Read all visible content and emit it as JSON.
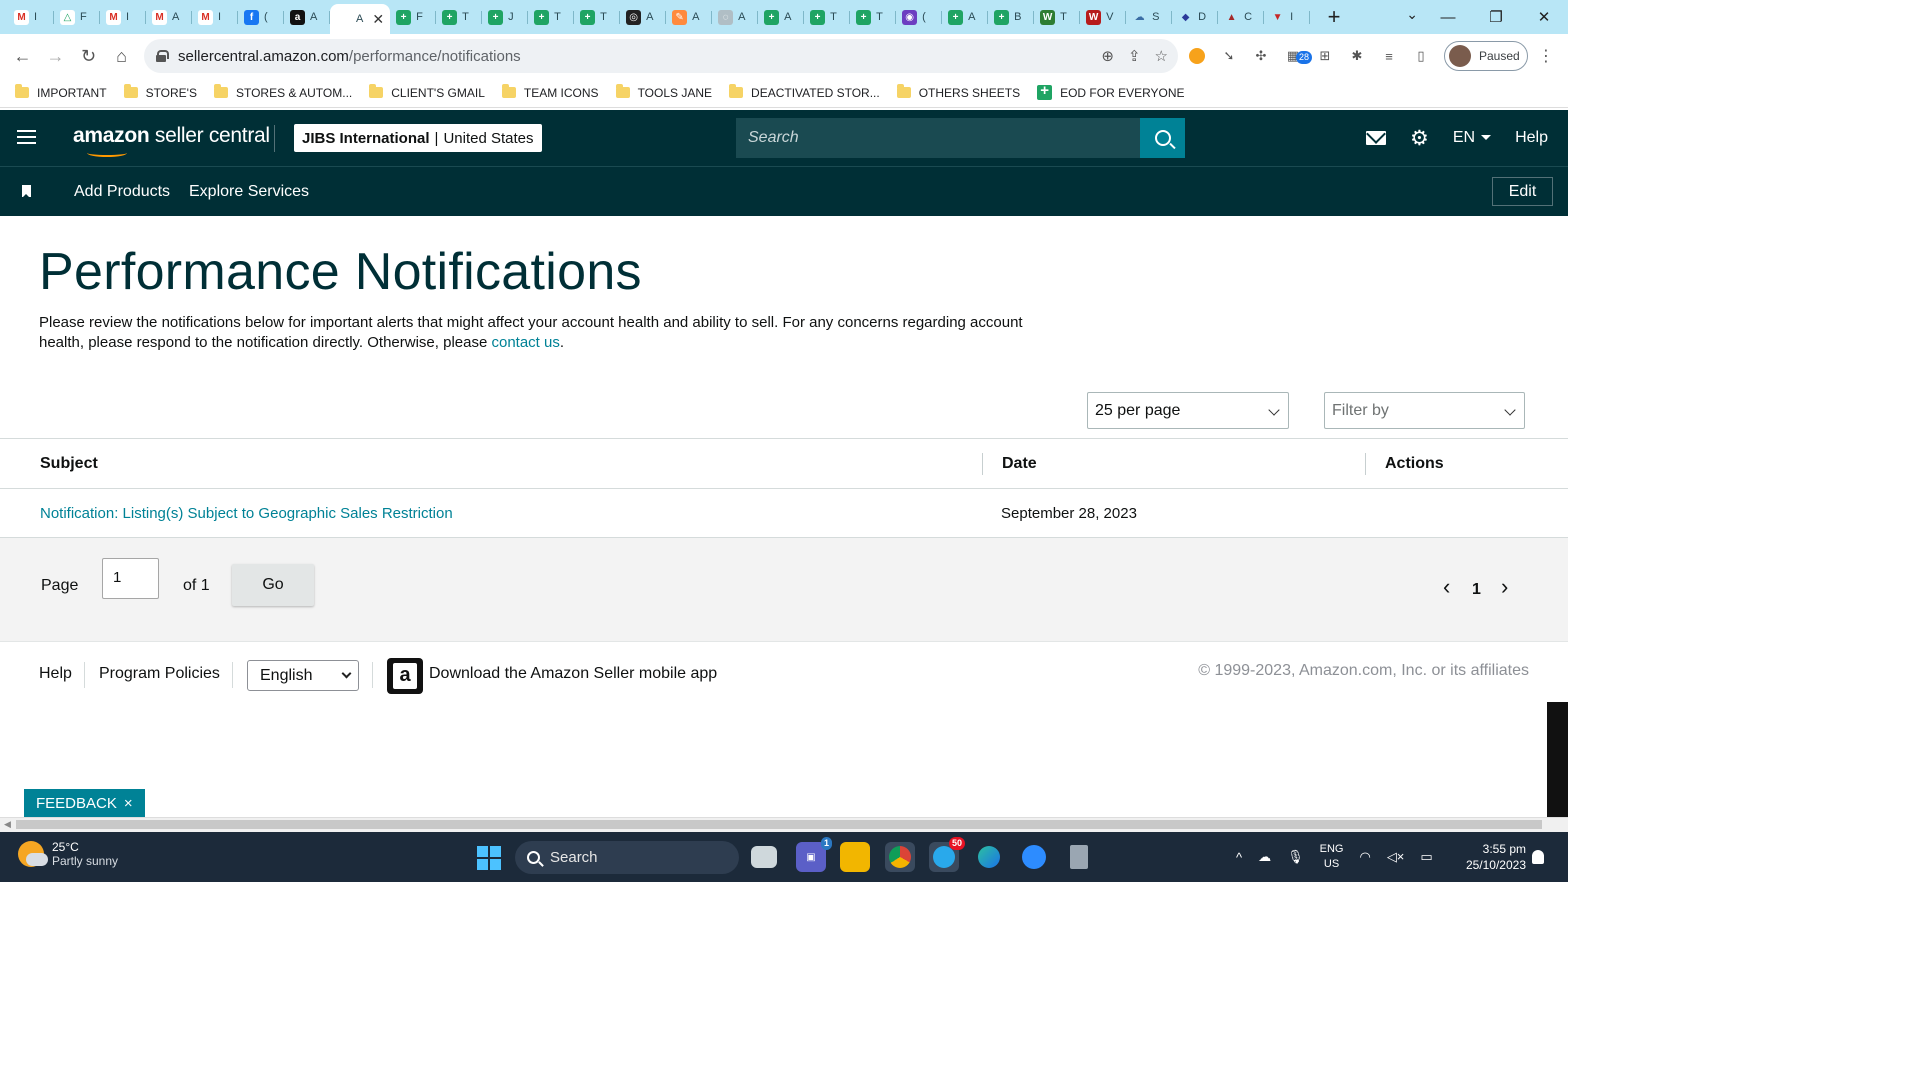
{
  "browser": {
    "tabs": [
      {
        "label": "I",
        "icon": "gmail-icon",
        "letter": "M",
        "bg": "#ffffff",
        "fg": "#d93025"
      },
      {
        "label": "F",
        "icon": "drive-icon",
        "letter": "△",
        "bg": "#ffffff",
        "fg": "#1fa463"
      },
      {
        "label": "I",
        "icon": "gmail-icon",
        "letter": "M",
        "bg": "#ffffff",
        "fg": "#d93025"
      },
      {
        "label": "A",
        "icon": "gmail-icon",
        "letter": "M",
        "bg": "#ffffff",
        "fg": "#d93025"
      },
      {
        "label": "I",
        "icon": "gmail-icon",
        "letter": "M",
        "bg": "#ffffff",
        "fg": "#d93025"
      },
      {
        "label": "(",
        "icon": "facebook-icon",
        "letter": "f",
        "bg": "#1877f2",
        "fg": "#ffffff"
      },
      {
        "label": "A",
        "icon": "amazon-icon",
        "letter": "a",
        "bg": "#111111",
        "fg": "#ffffff"
      },
      {
        "label": "A",
        "icon": "amazon-icon",
        "letter": "",
        "bg": "transparent",
        "fg": "#333333",
        "active": true
      },
      {
        "label": "F",
        "icon": "sheets-icon",
        "letter": "+",
        "bg": "#1fa463",
        "fg": "#ffffff"
      },
      {
        "label": "T",
        "icon": "sheets-icon",
        "letter": "+",
        "bg": "#1fa463",
        "fg": "#ffffff"
      },
      {
        "label": "J",
        "icon": "sheets-icon",
        "letter": "+",
        "bg": "#1fa463",
        "fg": "#ffffff"
      },
      {
        "label": "T",
        "icon": "sheets-icon",
        "letter": "+",
        "bg": "#1fa463",
        "fg": "#ffffff"
      },
      {
        "label": "T",
        "icon": "sheets-icon",
        "letter": "+",
        "bg": "#1fa463",
        "fg": "#ffffff"
      },
      {
        "label": "A",
        "icon": "openai-icon",
        "letter": "◎",
        "bg": "#222222",
        "fg": "#ffffff"
      },
      {
        "label": "A",
        "icon": "pencil-icon",
        "letter": "✎",
        "bg": "#ff8a3d",
        "fg": "#ffffff"
      },
      {
        "label": "A",
        "icon": "globe-icon",
        "letter": "◌",
        "bg": "#b0bec5",
        "fg": "#ffffff"
      },
      {
        "label": "A",
        "icon": "sheets-icon",
        "letter": "+",
        "bg": "#1fa463",
        "fg": "#ffffff"
      },
      {
        "label": "T",
        "icon": "sheets-icon",
        "letter": "+",
        "bg": "#1fa463",
        "fg": "#ffffff"
      },
      {
        "label": "T",
        "icon": "sheets-icon",
        "letter": "+",
        "bg": "#1fa463",
        "fg": "#ffffff"
      },
      {
        "label": "(",
        "icon": "chat-icon",
        "letter": "◉",
        "bg": "#6c3ec1",
        "fg": "#ffffff"
      },
      {
        "label": "A",
        "icon": "sheets-icon",
        "letter": "+",
        "bg": "#1fa463",
        "fg": "#ffffff"
      },
      {
        "label": "B",
        "icon": "sheets-icon",
        "letter": "+",
        "bg": "#1fa463",
        "fg": "#ffffff"
      },
      {
        "label": "T",
        "icon": "w-icon",
        "letter": "W",
        "bg": "#2e7d32",
        "fg": "#ffffff"
      },
      {
        "label": "V",
        "icon": "ww-icon",
        "letter": "W",
        "bg": "#b71c1c",
        "fg": "#ffffff"
      },
      {
        "label": "S",
        "icon": "cloud-icon",
        "letter": "☁",
        "bg": "transparent",
        "fg": "#3b6ea5"
      },
      {
        "label": "D",
        "icon": "dropbox-icon",
        "letter": "◆",
        "bg": "transparent",
        "fg": "#2b3a9a"
      },
      {
        "label": "C",
        "icon": "mountain-icon",
        "letter": "▲",
        "bg": "transparent",
        "fg": "#a52a2a"
      },
      {
        "label": "I",
        "icon": "shield-icon",
        "letter": "▼",
        "bg": "transparent",
        "fg": "#c62828"
      }
    ],
    "url_host": "sellercentral.amazon.com",
    "url_path": "/performance/notifications",
    "profile_label": "Paused",
    "ext_badge": "28",
    "bookmarks": [
      {
        "label": "IMPORTANT",
        "type": "folder"
      },
      {
        "label": "STORE'S",
        "type": "folder"
      },
      {
        "label": "STORES & AUTOM...",
        "type": "folder"
      },
      {
        "label": "CLIENT'S GMAIL",
        "type": "folder"
      },
      {
        "label": "TEAM ICONS",
        "type": "folder"
      },
      {
        "label": "TOOLS JANE",
        "type": "folder"
      },
      {
        "label": "DEACTIVATED STOR...",
        "type": "folder"
      },
      {
        "label": "OTHERS SHEETS",
        "type": "folder"
      },
      {
        "label": "EOD FOR EVERYONE",
        "type": "sheet"
      }
    ]
  },
  "header": {
    "logo_bold": "amazon",
    "logo_rest": " seller central",
    "account_name": "JIBS International",
    "account_separator": "|",
    "account_region": "United States",
    "search_placeholder": "Search",
    "language": "EN",
    "help": "Help"
  },
  "subnav": {
    "add_products": "Add Products",
    "explore_services": "Explore Services",
    "edit": "Edit"
  },
  "main": {
    "title": "Performance Notifications",
    "intro_text": "Please review the notifications below for important alerts that might affect your account health and ability to sell. For any concerns regarding account health, please respond to the notification directly. Otherwise, please ",
    "intro_link": "contact us",
    "intro_end": ".",
    "per_page": "25 per page",
    "filter_placeholder": "Filter by",
    "columns": {
      "subject": "Subject",
      "date": "Date",
      "actions": "Actions"
    },
    "rows": [
      {
        "subject": "Notification: Listing(s) Subject to Geographic Sales Restriction",
        "date": "September 28, 2023",
        "actions": ""
      }
    ],
    "pager": {
      "page_label": "Page",
      "page_value": "1",
      "of_label": "of 1",
      "go_label": "Go",
      "prev": "‹",
      "current": "1",
      "next": "›"
    }
  },
  "footer": {
    "help": "Help",
    "program_policies": "Program Policies",
    "language_selected": "English",
    "app_text": "Download the Amazon Seller mobile app",
    "copyright": "© 1999-2023, Amazon.com, Inc. or its affiliates",
    "feedback": "FEEDBACK",
    "feedback_close": "×"
  },
  "taskbar": {
    "temperature": "25°C",
    "weather": "Partly sunny",
    "search": "Search",
    "teams_badge": "1",
    "telegram_badge": "50",
    "lang_top": "ENG",
    "lang_bottom": "US",
    "time": "3:55 pm",
    "date": "25/10/2023"
  },
  "colors": {
    "header_bg": "#002f36",
    "link": "#008296",
    "tabstrip_bg": "#b8e6f6"
  }
}
